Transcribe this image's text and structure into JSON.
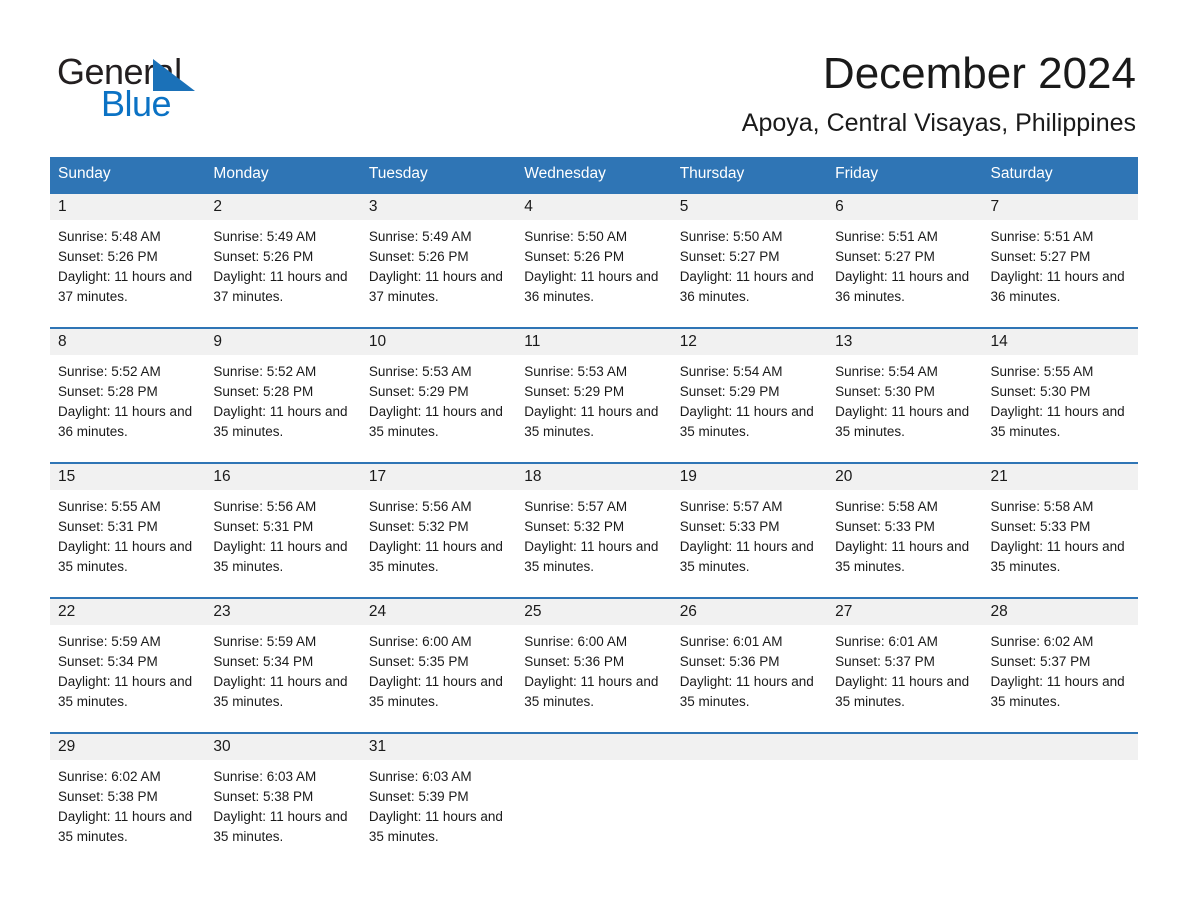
{
  "brand": {
    "word1": "General",
    "word2": "Blue",
    "triangle_color": "#1b71b8",
    "blue_color": "#0b72c4"
  },
  "header": {
    "month_title": "December 2024",
    "location": "Apoya, Central Visayas, Philippines"
  },
  "theme": {
    "header_blue": "#2f75b5",
    "daynum_band": "#f1f1f1",
    "text": "#1a1a1a"
  },
  "weekday_headers": [
    "Sunday",
    "Monday",
    "Tuesday",
    "Wednesday",
    "Thursday",
    "Friday",
    "Saturday"
  ],
  "weeks": [
    [
      {
        "day": "1",
        "sunrise": "Sunrise: 5:48 AM",
        "sunset": "Sunset: 5:26 PM",
        "daylight": "Daylight: 11 hours and 37 minutes."
      },
      {
        "day": "2",
        "sunrise": "Sunrise: 5:49 AM",
        "sunset": "Sunset: 5:26 PM",
        "daylight": "Daylight: 11 hours and 37 minutes."
      },
      {
        "day": "3",
        "sunrise": "Sunrise: 5:49 AM",
        "sunset": "Sunset: 5:26 PM",
        "daylight": "Daylight: 11 hours and 37 minutes."
      },
      {
        "day": "4",
        "sunrise": "Sunrise: 5:50 AM",
        "sunset": "Sunset: 5:26 PM",
        "daylight": "Daylight: 11 hours and 36 minutes."
      },
      {
        "day": "5",
        "sunrise": "Sunrise: 5:50 AM",
        "sunset": "Sunset: 5:27 PM",
        "daylight": "Daylight: 11 hours and 36 minutes."
      },
      {
        "day": "6",
        "sunrise": "Sunrise: 5:51 AM",
        "sunset": "Sunset: 5:27 PM",
        "daylight": "Daylight: 11 hours and 36 minutes."
      },
      {
        "day": "7",
        "sunrise": "Sunrise: 5:51 AM",
        "sunset": "Sunset: 5:27 PM",
        "daylight": "Daylight: 11 hours and 36 minutes."
      }
    ],
    [
      {
        "day": "8",
        "sunrise": "Sunrise: 5:52 AM",
        "sunset": "Sunset: 5:28 PM",
        "daylight": "Daylight: 11 hours and 36 minutes."
      },
      {
        "day": "9",
        "sunrise": "Sunrise: 5:52 AM",
        "sunset": "Sunset: 5:28 PM",
        "daylight": "Daylight: 11 hours and 35 minutes."
      },
      {
        "day": "10",
        "sunrise": "Sunrise: 5:53 AM",
        "sunset": "Sunset: 5:29 PM",
        "daylight": "Daylight: 11 hours and 35 minutes."
      },
      {
        "day": "11",
        "sunrise": "Sunrise: 5:53 AM",
        "sunset": "Sunset: 5:29 PM",
        "daylight": "Daylight: 11 hours and 35 minutes."
      },
      {
        "day": "12",
        "sunrise": "Sunrise: 5:54 AM",
        "sunset": "Sunset: 5:29 PM",
        "daylight": "Daylight: 11 hours and 35 minutes."
      },
      {
        "day": "13",
        "sunrise": "Sunrise: 5:54 AM",
        "sunset": "Sunset: 5:30 PM",
        "daylight": "Daylight: 11 hours and 35 minutes."
      },
      {
        "day": "14",
        "sunrise": "Sunrise: 5:55 AM",
        "sunset": "Sunset: 5:30 PM",
        "daylight": "Daylight: 11 hours and 35 minutes."
      }
    ],
    [
      {
        "day": "15",
        "sunrise": "Sunrise: 5:55 AM",
        "sunset": "Sunset: 5:31 PM",
        "daylight": "Daylight: 11 hours and 35 minutes."
      },
      {
        "day": "16",
        "sunrise": "Sunrise: 5:56 AM",
        "sunset": "Sunset: 5:31 PM",
        "daylight": "Daylight: 11 hours and 35 minutes."
      },
      {
        "day": "17",
        "sunrise": "Sunrise: 5:56 AM",
        "sunset": "Sunset: 5:32 PM",
        "daylight": "Daylight: 11 hours and 35 minutes."
      },
      {
        "day": "18",
        "sunrise": "Sunrise: 5:57 AM",
        "sunset": "Sunset: 5:32 PM",
        "daylight": "Daylight: 11 hours and 35 minutes."
      },
      {
        "day": "19",
        "sunrise": "Sunrise: 5:57 AM",
        "sunset": "Sunset: 5:33 PM",
        "daylight": "Daylight: 11 hours and 35 minutes."
      },
      {
        "day": "20",
        "sunrise": "Sunrise: 5:58 AM",
        "sunset": "Sunset: 5:33 PM",
        "daylight": "Daylight: 11 hours and 35 minutes."
      },
      {
        "day": "21",
        "sunrise": "Sunrise: 5:58 AM",
        "sunset": "Sunset: 5:33 PM",
        "daylight": "Daylight: 11 hours and 35 minutes."
      }
    ],
    [
      {
        "day": "22",
        "sunrise": "Sunrise: 5:59 AM",
        "sunset": "Sunset: 5:34 PM",
        "daylight": "Daylight: 11 hours and 35 minutes."
      },
      {
        "day": "23",
        "sunrise": "Sunrise: 5:59 AM",
        "sunset": "Sunset: 5:34 PM",
        "daylight": "Daylight: 11 hours and 35 minutes."
      },
      {
        "day": "24",
        "sunrise": "Sunrise: 6:00 AM",
        "sunset": "Sunset: 5:35 PM",
        "daylight": "Daylight: 11 hours and 35 minutes."
      },
      {
        "day": "25",
        "sunrise": "Sunrise: 6:00 AM",
        "sunset": "Sunset: 5:36 PM",
        "daylight": "Daylight: 11 hours and 35 minutes."
      },
      {
        "day": "26",
        "sunrise": "Sunrise: 6:01 AM",
        "sunset": "Sunset: 5:36 PM",
        "daylight": "Daylight: 11 hours and 35 minutes."
      },
      {
        "day": "27",
        "sunrise": "Sunrise: 6:01 AM",
        "sunset": "Sunset: 5:37 PM",
        "daylight": "Daylight: 11 hours and 35 minutes."
      },
      {
        "day": "28",
        "sunrise": "Sunrise: 6:02 AM",
        "sunset": "Sunset: 5:37 PM",
        "daylight": "Daylight: 11 hours and 35 minutes."
      }
    ],
    [
      {
        "day": "29",
        "sunrise": "Sunrise: 6:02 AM",
        "sunset": "Sunset: 5:38 PM",
        "daylight": "Daylight: 11 hours and 35 minutes."
      },
      {
        "day": "30",
        "sunrise": "Sunrise: 6:03 AM",
        "sunset": "Sunset: 5:38 PM",
        "daylight": "Daylight: 11 hours and 35 minutes."
      },
      {
        "day": "31",
        "sunrise": "Sunrise: 6:03 AM",
        "sunset": "Sunset: 5:39 PM",
        "daylight": "Daylight: 11 hours and 35 minutes."
      },
      {
        "day": "",
        "sunrise": "",
        "sunset": "",
        "daylight": ""
      },
      {
        "day": "",
        "sunrise": "",
        "sunset": "",
        "daylight": ""
      },
      {
        "day": "",
        "sunrise": "",
        "sunset": "",
        "daylight": ""
      },
      {
        "day": "",
        "sunrise": "",
        "sunset": "",
        "daylight": ""
      }
    ]
  ]
}
